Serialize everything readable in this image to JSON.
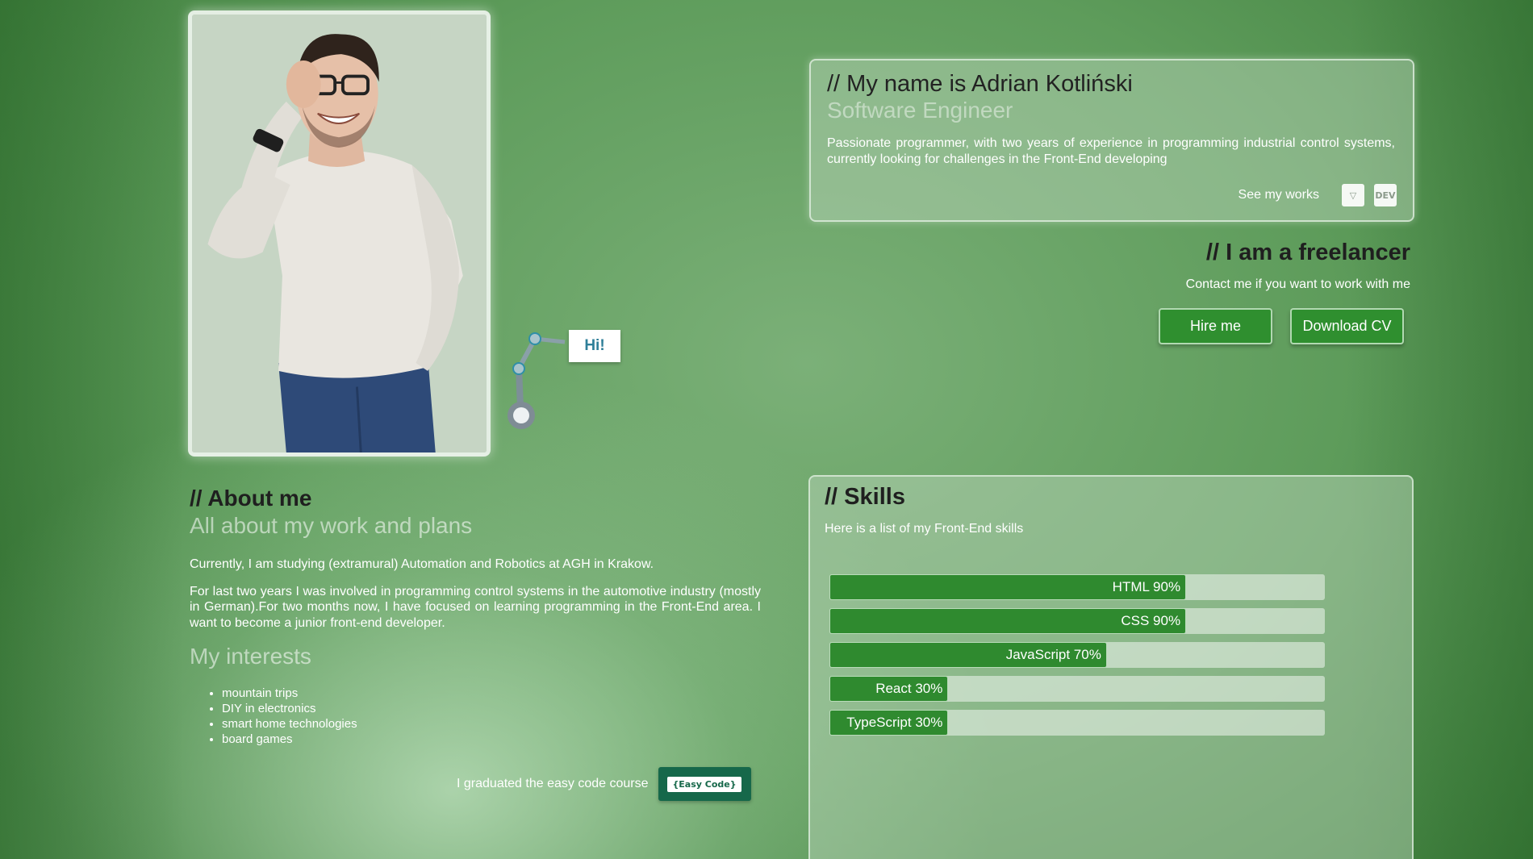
{
  "hero": {
    "bubble": "Hi!"
  },
  "intro": {
    "title": "// My name is Adrian Kotliński",
    "subtitle": "Software Engineer",
    "description": "Passionate programmer, with two years of experience in programming industrial control systems, currently looking for challenges in the Front-End developing",
    "works_label": "See my works",
    "works_icons": [
      {
        "name": "codepen-icon",
        "glyph": "▽"
      },
      {
        "name": "dev-icon",
        "glyph": "DEV"
      }
    ]
  },
  "freelance": {
    "title": "// I am a freelancer",
    "description": "Contact me if you want to work with me",
    "hire_label": "Hire me",
    "cv_label": "Download CV"
  },
  "about": {
    "title": "// About me",
    "subtitle": "All about my work and plans",
    "p1": "Currently, I am studying (extramural) Automation and Robotics at AGH in Krakow.",
    "p2": "For last two years I was involved in programming control systems in the automotive industry (mostly in German).For two months now, I have focused on learning programming in the Front-End area. I want to become a junior front-end developer.",
    "interests_title": "My interests",
    "interests": [
      "mountain trips",
      "DIY in electronics",
      "smart home technologies",
      "board games"
    ],
    "graduated_label": "I graduated the easy code course",
    "badge_text": "{Easy Code}"
  },
  "skills": {
    "title": "// Skills",
    "description": "Here is a list of my Front-End skills",
    "items": [
      {
        "label": "HTML 90%",
        "level": 0.9
      },
      {
        "label": "CSS 90%",
        "level": 0.9
      },
      {
        "label": "JavaScript 70%",
        "level": 0.7
      },
      {
        "label": "React 30%",
        "level": 0.3
      },
      {
        "label": "TypeScript 30%",
        "level": 0.3
      }
    ]
  },
  "colors": {
    "accent": "#2f8a2f",
    "badge": "#16684a",
    "bubble_text": "#2f7f99"
  }
}
